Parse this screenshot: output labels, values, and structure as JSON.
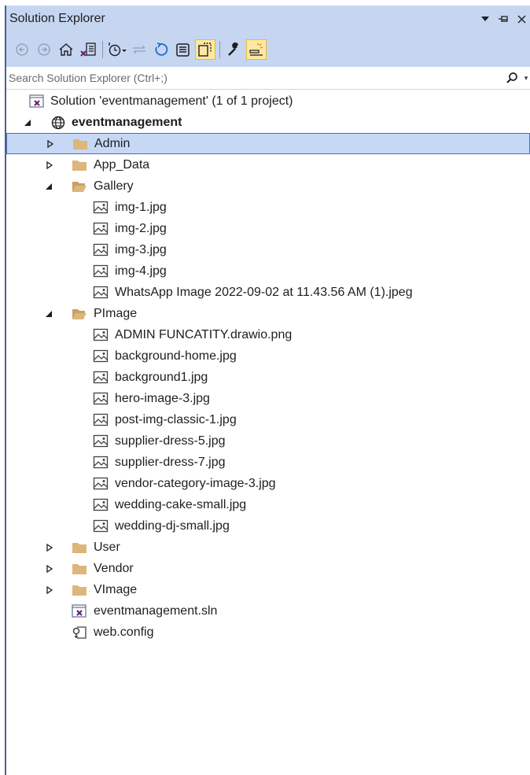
{
  "window": {
    "title": "Solution Explorer",
    "title_buttons": [
      "chevron-down-icon",
      "pin-icon",
      "close-icon"
    ]
  },
  "toolbar": {
    "buttons": [
      "back-icon",
      "forward-icon",
      "home-icon",
      "switch-views-icon",
      "pending-changes-filter-icon",
      "sync-active-document-icon",
      "refresh-icon",
      "collapse-all-icon",
      "show-all-files-icon",
      "properties-icon",
      "preview-selected-items-icon"
    ]
  },
  "search": {
    "placeholder": "Search Solution Explorer (Ctrl+;)"
  },
  "tree": {
    "solution": "Solution 'eventmanagement' (1 of 1 project)",
    "project": "eventmanagement",
    "admin": "Admin",
    "app_data": "App_Data",
    "gallery": "Gallery",
    "gallery_files": [
      "img-1.jpg",
      "img-2.jpg",
      "img-3.jpg",
      "img-4.jpg",
      "WhatsApp Image 2022-09-02 at 11.43.56 AM (1).jpeg"
    ],
    "pimage": "PImage",
    "pimage_files": [
      "ADMIN FUNCATITY.drawio.png",
      "background-home.jpg",
      "background1.jpg",
      "hero-image-3.jpg",
      "post-img-classic-1.jpg",
      "supplier-dress-5.jpg",
      "supplier-dress-7.jpg",
      "vendor-category-image-3.jpg",
      "wedding-cake-small.jpg",
      "wedding-dj-small.jpg"
    ],
    "user": "User",
    "vendor": "Vendor",
    "vimage": "VImage",
    "sln_file": "eventmanagement.sln",
    "config_file": "web.config"
  },
  "colors": {
    "panel_header": "#c6d6f1",
    "frame_border": "#49618f",
    "selection": "#c7d8f6",
    "folder": "#dcb67a"
  }
}
